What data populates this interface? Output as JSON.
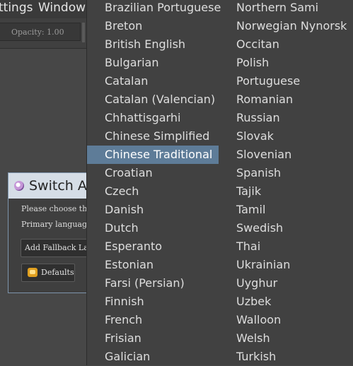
{
  "menubar": {
    "items": [
      {
        "label": "ttings"
      },
      {
        "label": "Window"
      }
    ]
  },
  "toolbar": {
    "opacity_text": "Opacity:  1.00"
  },
  "dialog": {
    "title": "Switch Ap",
    "prompt": "Please choose the la",
    "primary_label": "Primary language:",
    "fallback_button": "Add Fallback Lang",
    "defaults_button": "Defaults",
    "accent_color": "#d5dde6"
  },
  "language_menu": {
    "selected": "Chinese Traditional",
    "highlight_color": "#5e7c98",
    "column1": [
      "Brazilian Portuguese",
      "Breton",
      "British English",
      "Bulgarian",
      "Catalan",
      "Catalan (Valencian)",
      "Chhattisgarhi",
      "Chinese Simplified",
      "Chinese Traditional",
      "Croatian",
      "Czech",
      "Danish",
      "Dutch",
      "Esperanto",
      "Estonian",
      "Farsi (Persian)",
      "Finnish",
      "French",
      "Frisian",
      "Galician"
    ],
    "column2": [
      "Northern Sami",
      "Norwegian Nynorsk",
      "Occitan",
      "Polish",
      "Portuguese",
      "Romanian",
      "Russian",
      "Slovak",
      "Slovenian",
      "Spanish",
      "Tajik",
      "Tamil",
      "Swedish",
      "Thai",
      "Ukrainian",
      "Uyghur",
      "Uzbek",
      "Walloon",
      "Welsh",
      "Turkish"
    ]
  }
}
